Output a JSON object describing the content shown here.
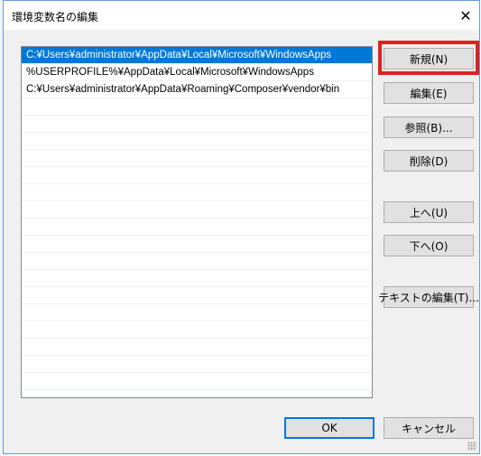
{
  "dialog": {
    "title": "環境変数名の編集",
    "close_glyph": "✕"
  },
  "paths": [
    "C:¥Users¥administrator¥AppData¥Local¥Microsoft¥WindowsApps",
    "%USERPROFILE%¥AppData¥Local¥Microsoft¥WindowsApps",
    "C:¥Users¥administrator¥AppData¥Roaming¥Composer¥vendor¥bin"
  ],
  "selected_index": 0,
  "buttons": {
    "new": "新規(N)",
    "edit": "編集(E)",
    "browse": "参照(B)...",
    "delete": "削除(D)",
    "move_up": "上へ(U)",
    "move_down": "下へ(O)",
    "edit_text": "テキストの編集(T)...",
    "ok": "OK",
    "cancel": "キャンセル"
  },
  "colors": {
    "selection": "#0078d7",
    "highlight_box": "#e02020"
  }
}
